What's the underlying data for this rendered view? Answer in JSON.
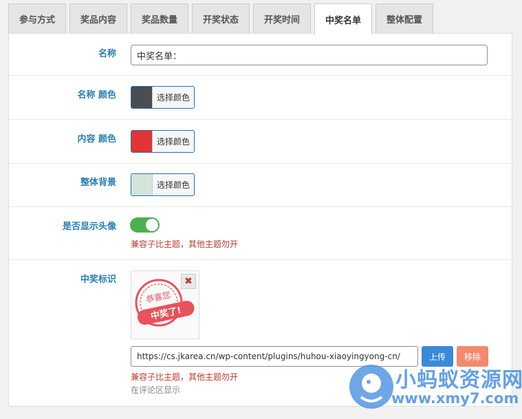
{
  "tabs": [
    {
      "label": "参与方式",
      "active": false
    },
    {
      "label": "奖品内容",
      "active": false
    },
    {
      "label": "奖品数量",
      "active": false
    },
    {
      "label": "开奖状态",
      "active": false
    },
    {
      "label": "开奖时间",
      "active": false
    },
    {
      "label": "中奖名单",
      "active": true
    },
    {
      "label": "整体配置",
      "active": false
    }
  ],
  "fields": {
    "name": {
      "label": "名称",
      "value": "中奖名单："
    },
    "name_color": {
      "label": "名称 颜色",
      "button": "选择颜色",
      "color": "#4a4d52"
    },
    "content_color": {
      "label": "内容 颜色",
      "button": "选择颜色",
      "color": "#e03535"
    },
    "background": {
      "label": "整体背景",
      "button": "选择颜色",
      "color": "#d3e5d8"
    },
    "show_avatar": {
      "label": "是否显示头像",
      "enabled": true,
      "note": "兼容子比主题，其他主题勿开"
    },
    "winner_badge": {
      "label": "中奖标识",
      "stamp_top": "恭喜您",
      "stamp_main": "中奖了!",
      "remove_icon": "close-icon",
      "url": "https://cs.jkarea.cn/wp-content/plugins/huhou-xiaoyingyong-cn/",
      "upload_label": "上传",
      "remove_label": "移除",
      "note": "兼容子比主题，其他主题勿开",
      "note2": "在评论区显示"
    }
  },
  "watermark": {
    "title": "小蚂蚁资源网",
    "url": "www.xmy7.com"
  },
  "colors": {
    "accent": "#2a7fb6",
    "toggle_on": "#4caf50",
    "note": "#c0392b"
  }
}
